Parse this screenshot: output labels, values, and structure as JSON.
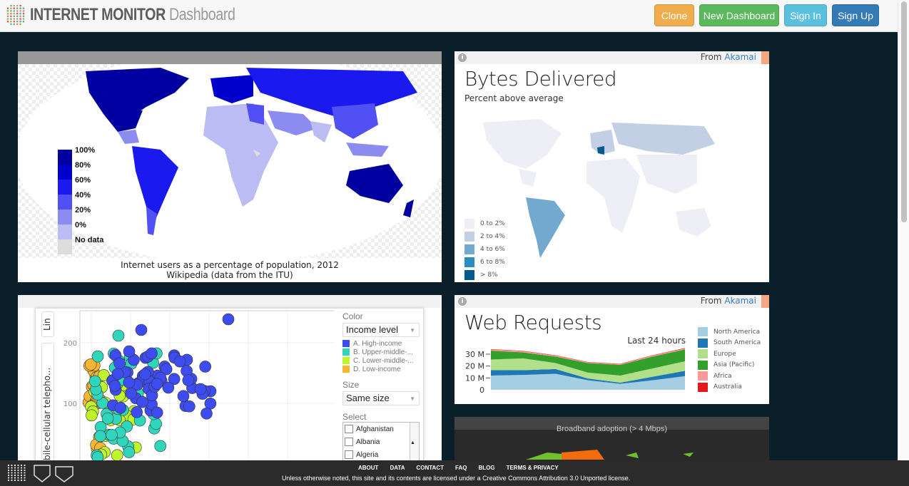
{
  "header": {
    "brand_bold": "INTERNET MONITOR",
    "brand_light": "Dashboard",
    "buttons": [
      {
        "label": "Clone",
        "color": "#f0ad4e"
      },
      {
        "label": "New Dashboard",
        "color": "#5cb85c"
      },
      {
        "label": "Sign In",
        "color": "#5bc0de"
      },
      {
        "label": "Sign Up",
        "color": "#337ab7"
      }
    ]
  },
  "wiki_map": {
    "legend": [
      "100%",
      "80%",
      "60%",
      "40%",
      "20%",
      "0%",
      "No data"
    ],
    "legend_colors": [
      "#0000a0",
      "#0000cc",
      "#1a1aee",
      "#5050f5",
      "#8c8cf0",
      "#bcbcf5",
      "#dddddd"
    ],
    "caption_line1": "Internet users as a percentage of population, 2012",
    "caption_line2": "Wikipedia (data from the ITU)"
  },
  "bytes": {
    "source_prefix": "From",
    "source": "Akamai",
    "title": "Bytes Delivered",
    "subtitle": "Percent above average",
    "legend": [
      "0 to 2%",
      "2 to 4%",
      "4 to 6%",
      "6 to 8%",
      "> 8%"
    ],
    "legend_colors": [
      "#eeeef6",
      "#c3cfe4",
      "#74a9cf",
      "#2b8cbe",
      "#045a8d"
    ]
  },
  "scatter": {
    "y_axis_label": "bile-cellular telepho...",
    "line_btn": "Lin",
    "y_ticks": [
      "200",
      "100"
    ],
    "color_label": "Color",
    "color_select": "Income level",
    "income_legend": [
      {
        "label": "A. High-income",
        "color": "#3d4cf0"
      },
      {
        "label": "B. Upper-middle-...",
        "color": "#2fd6bb"
      },
      {
        "label": "C. Lower-middle-...",
        "color": "#bff52a"
      },
      {
        "label": "D. Low-income",
        "color": "#fbb631"
      }
    ],
    "size_label": "Size",
    "size_select": "Same size",
    "select_label": "Select",
    "countries": [
      "Afghanistan",
      "Albania",
      "Algeria"
    ]
  },
  "web": {
    "source_prefix": "From",
    "source": "Akamai",
    "title": "Web Requests",
    "period": "Last 24 hours"
  },
  "chart_data": {
    "type": "area",
    "stacked": true,
    "title": "Web Requests",
    "subtitle": "Last 24 hours",
    "y_ticks": [
      "0",
      "10 M",
      "20 M",
      "30 M"
    ],
    "ylim": [
      0,
      35
    ],
    "legend_placement": "right",
    "series": [
      {
        "name": "North America",
        "color": "#a6cee3",
        "values": [
          12,
          12.5,
          13.5,
          8,
          5,
          8,
          11.5
        ]
      },
      {
        "name": "South America",
        "color": "#1f78b4",
        "values": [
          4.5,
          4,
          4,
          1.5,
          1,
          3,
          4.5
        ]
      },
      {
        "name": "Europe",
        "color": "#b2df8a",
        "values": [
          9,
          10,
          5,
          5,
          6,
          7,
          8
        ]
      },
      {
        "name": "Asia (Pacific)",
        "color": "#33a02c",
        "values": [
          7.5,
          5,
          5.5,
          8,
          9,
          10,
          10
        ]
      },
      {
        "name": "Africa",
        "color": "#fb9a99",
        "values": [
          1,
          1,
          0.8,
          0.6,
          0.6,
          0.8,
          0.8
        ]
      },
      {
        "name": "Australia",
        "color": "#e31a1c",
        "values": [
          0.3,
          0.3,
          0.3,
          0.3,
          0.3,
          0.3,
          0.4
        ]
      }
    ]
  },
  "broadband": {
    "title": "Broadband adoption (> 4 Mbps)"
  },
  "footer": {
    "links": [
      "ABOUT",
      "DATA",
      "CONTACT",
      "FAQ",
      "BLOG",
      "TERMS & PRIVACY"
    ],
    "license": "Unless otherwise noted, this site and its contents are licensed under a Creative Commons Attribution 3.0 Unported license."
  }
}
